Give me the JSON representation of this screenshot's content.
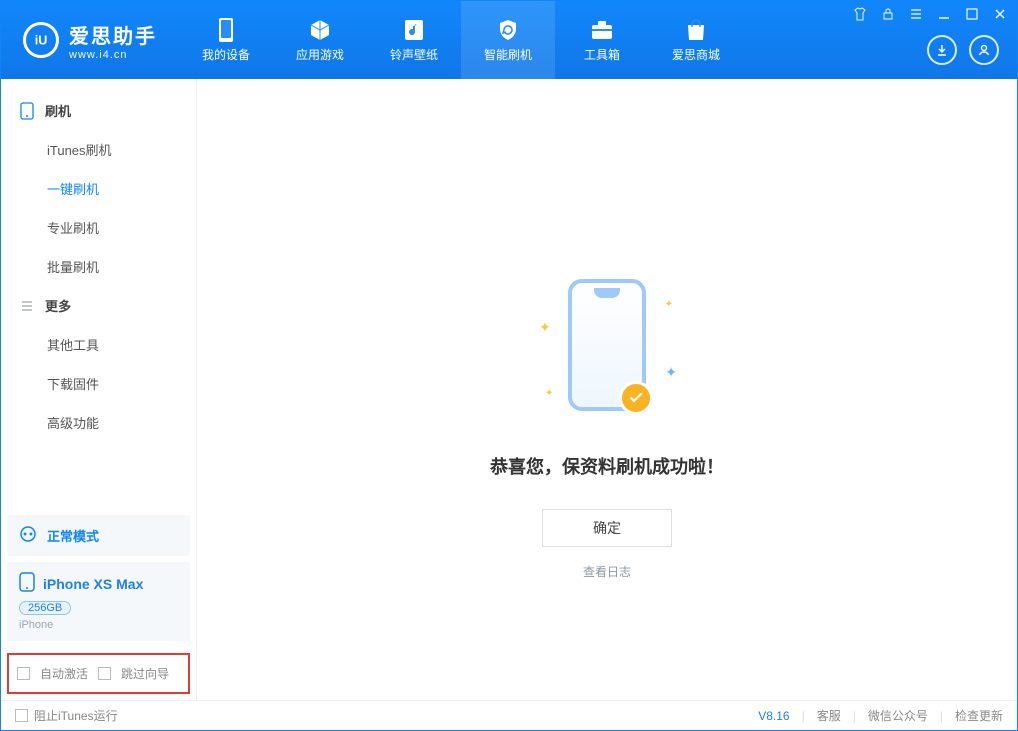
{
  "app": {
    "name": "爱思助手",
    "site": "www.i4.cn"
  },
  "tabs": [
    {
      "label": "我的设备"
    },
    {
      "label": "应用游戏"
    },
    {
      "label": "铃声壁纸"
    },
    {
      "label": "智能刷机"
    },
    {
      "label": "工具箱"
    },
    {
      "label": "爱思商城"
    }
  ],
  "sidebar": {
    "cat_flash": "刷机",
    "items_flash": [
      {
        "label": "iTunes刷机"
      },
      {
        "label": "一键刷机"
      },
      {
        "label": "专业刷机"
      },
      {
        "label": "批量刷机"
      }
    ],
    "cat_more": "更多",
    "items_more": [
      {
        "label": "其他工具"
      },
      {
        "label": "下载固件"
      },
      {
        "label": "高级功能"
      }
    ]
  },
  "mode_panel": {
    "label": "正常模式"
  },
  "device": {
    "name": "iPhone XS Max",
    "storage": "256GB",
    "type": "iPhone"
  },
  "checks": {
    "auto_activate": "自动激活",
    "skip_guide": "跳过向导"
  },
  "main": {
    "message": "恭喜您，保资料刷机成功啦！",
    "ok": "确定",
    "view_log": "查看日志"
  },
  "footer": {
    "block_itunes": "阻止iTunes运行",
    "version": "V8.16",
    "link_service": "客服",
    "link_wechat": "微信公众号",
    "link_update": "检查更新"
  }
}
